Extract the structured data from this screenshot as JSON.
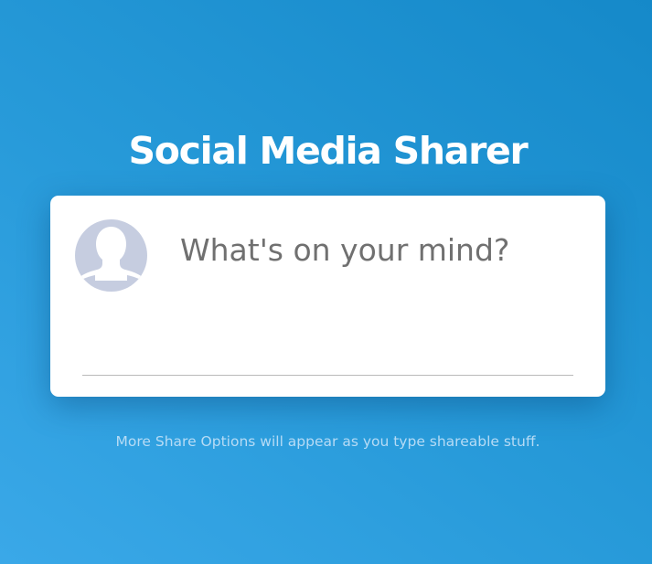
{
  "header": {
    "title": "Social Media Sharer"
  },
  "composer": {
    "avatar_icon": "default-user-silhouette-icon",
    "placeholder": "What's on your mind?",
    "value": ""
  },
  "hint": {
    "text": "More Share Options will appear as you type shareable stuff."
  },
  "colors": {
    "background_start": "#3aa8e8",
    "background_end": "#1589c9",
    "card": "#ffffff",
    "avatar": "#c6cde0",
    "title": "#ffffff",
    "hint": "#b6dbf5"
  }
}
